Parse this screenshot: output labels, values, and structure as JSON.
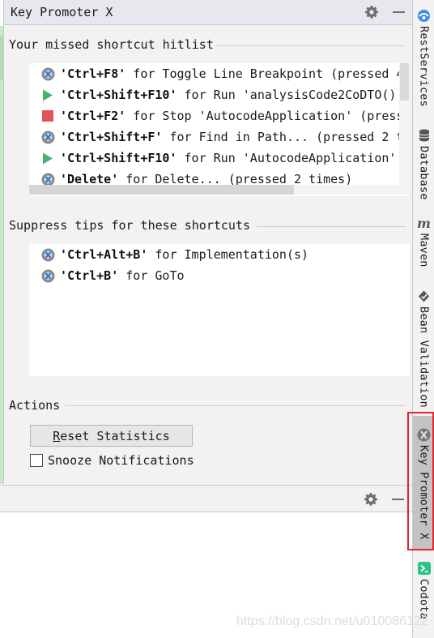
{
  "tool_window": {
    "title": "Key Promoter X",
    "settings_icon": "gear-icon",
    "minimize_icon": "minimize-icon"
  },
  "hitlist": {
    "label": "Your missed shortcut hitlist",
    "items": [
      {
        "icon": "key-promoter-icon",
        "shortcut": "'Ctrl+F8'",
        "text": " for Toggle Line Breakpoint (pressed 4"
      },
      {
        "icon": "run-icon",
        "shortcut": "'Ctrl+Shift+F10'",
        "text": " for Run 'analysisCode2CoDTO()'"
      },
      {
        "icon": "stop-icon",
        "shortcut": "'Ctrl+F2'",
        "text": " for Stop 'AutocodeApplication' (press"
      },
      {
        "icon": "key-promoter-icon",
        "shortcut": "'Ctrl+Shift+F'",
        "text": " for Find in Path... (pressed 2 t"
      },
      {
        "icon": "run-icon",
        "shortcut": "'Ctrl+Shift+F10'",
        "text": " for Run 'AutocodeApplication'"
      },
      {
        "icon": "key-promoter-icon",
        "shortcut": "'Delete'",
        "text": " for Delete... (pressed 2 times)"
      }
    ]
  },
  "suppress": {
    "label": "Suppress tips for these shortcuts",
    "items": [
      {
        "icon": "key-promoter-icon",
        "shortcut": "'Ctrl+Alt+B'",
        "text": " for Implementation(s)"
      },
      {
        "icon": "key-promoter-icon",
        "shortcut": "'Ctrl+B'",
        "text": " for GoTo"
      }
    ]
  },
  "actions": {
    "label": "Actions",
    "reset_button_mnemonic": "R",
    "reset_button_rest": "eset Statistics",
    "snooze_label": "Snooze Notifications",
    "snooze_checked": false
  },
  "right_stripe": {
    "items": [
      {
        "label": "RestServices",
        "icon": "rest-services-icon"
      },
      {
        "label": "Database",
        "icon": "database-icon"
      },
      {
        "label": "Maven",
        "icon": "maven-icon"
      },
      {
        "label": "Bean Validation",
        "icon": "bean-validation-icon"
      },
      {
        "label": "Key Promoter X",
        "icon": "key-promoter-icon",
        "active": true
      },
      {
        "label": "Codota",
        "icon": "codota-icon"
      }
    ]
  },
  "watermark": "https://blog.csdn.net/u010086122",
  "colors": {
    "run_green": "#4caf6a",
    "stop_red": "#e05555",
    "highlight_red": "#e0282e",
    "rest_blue": "#3a8ee6",
    "codota_teal": "#2bc48a"
  }
}
